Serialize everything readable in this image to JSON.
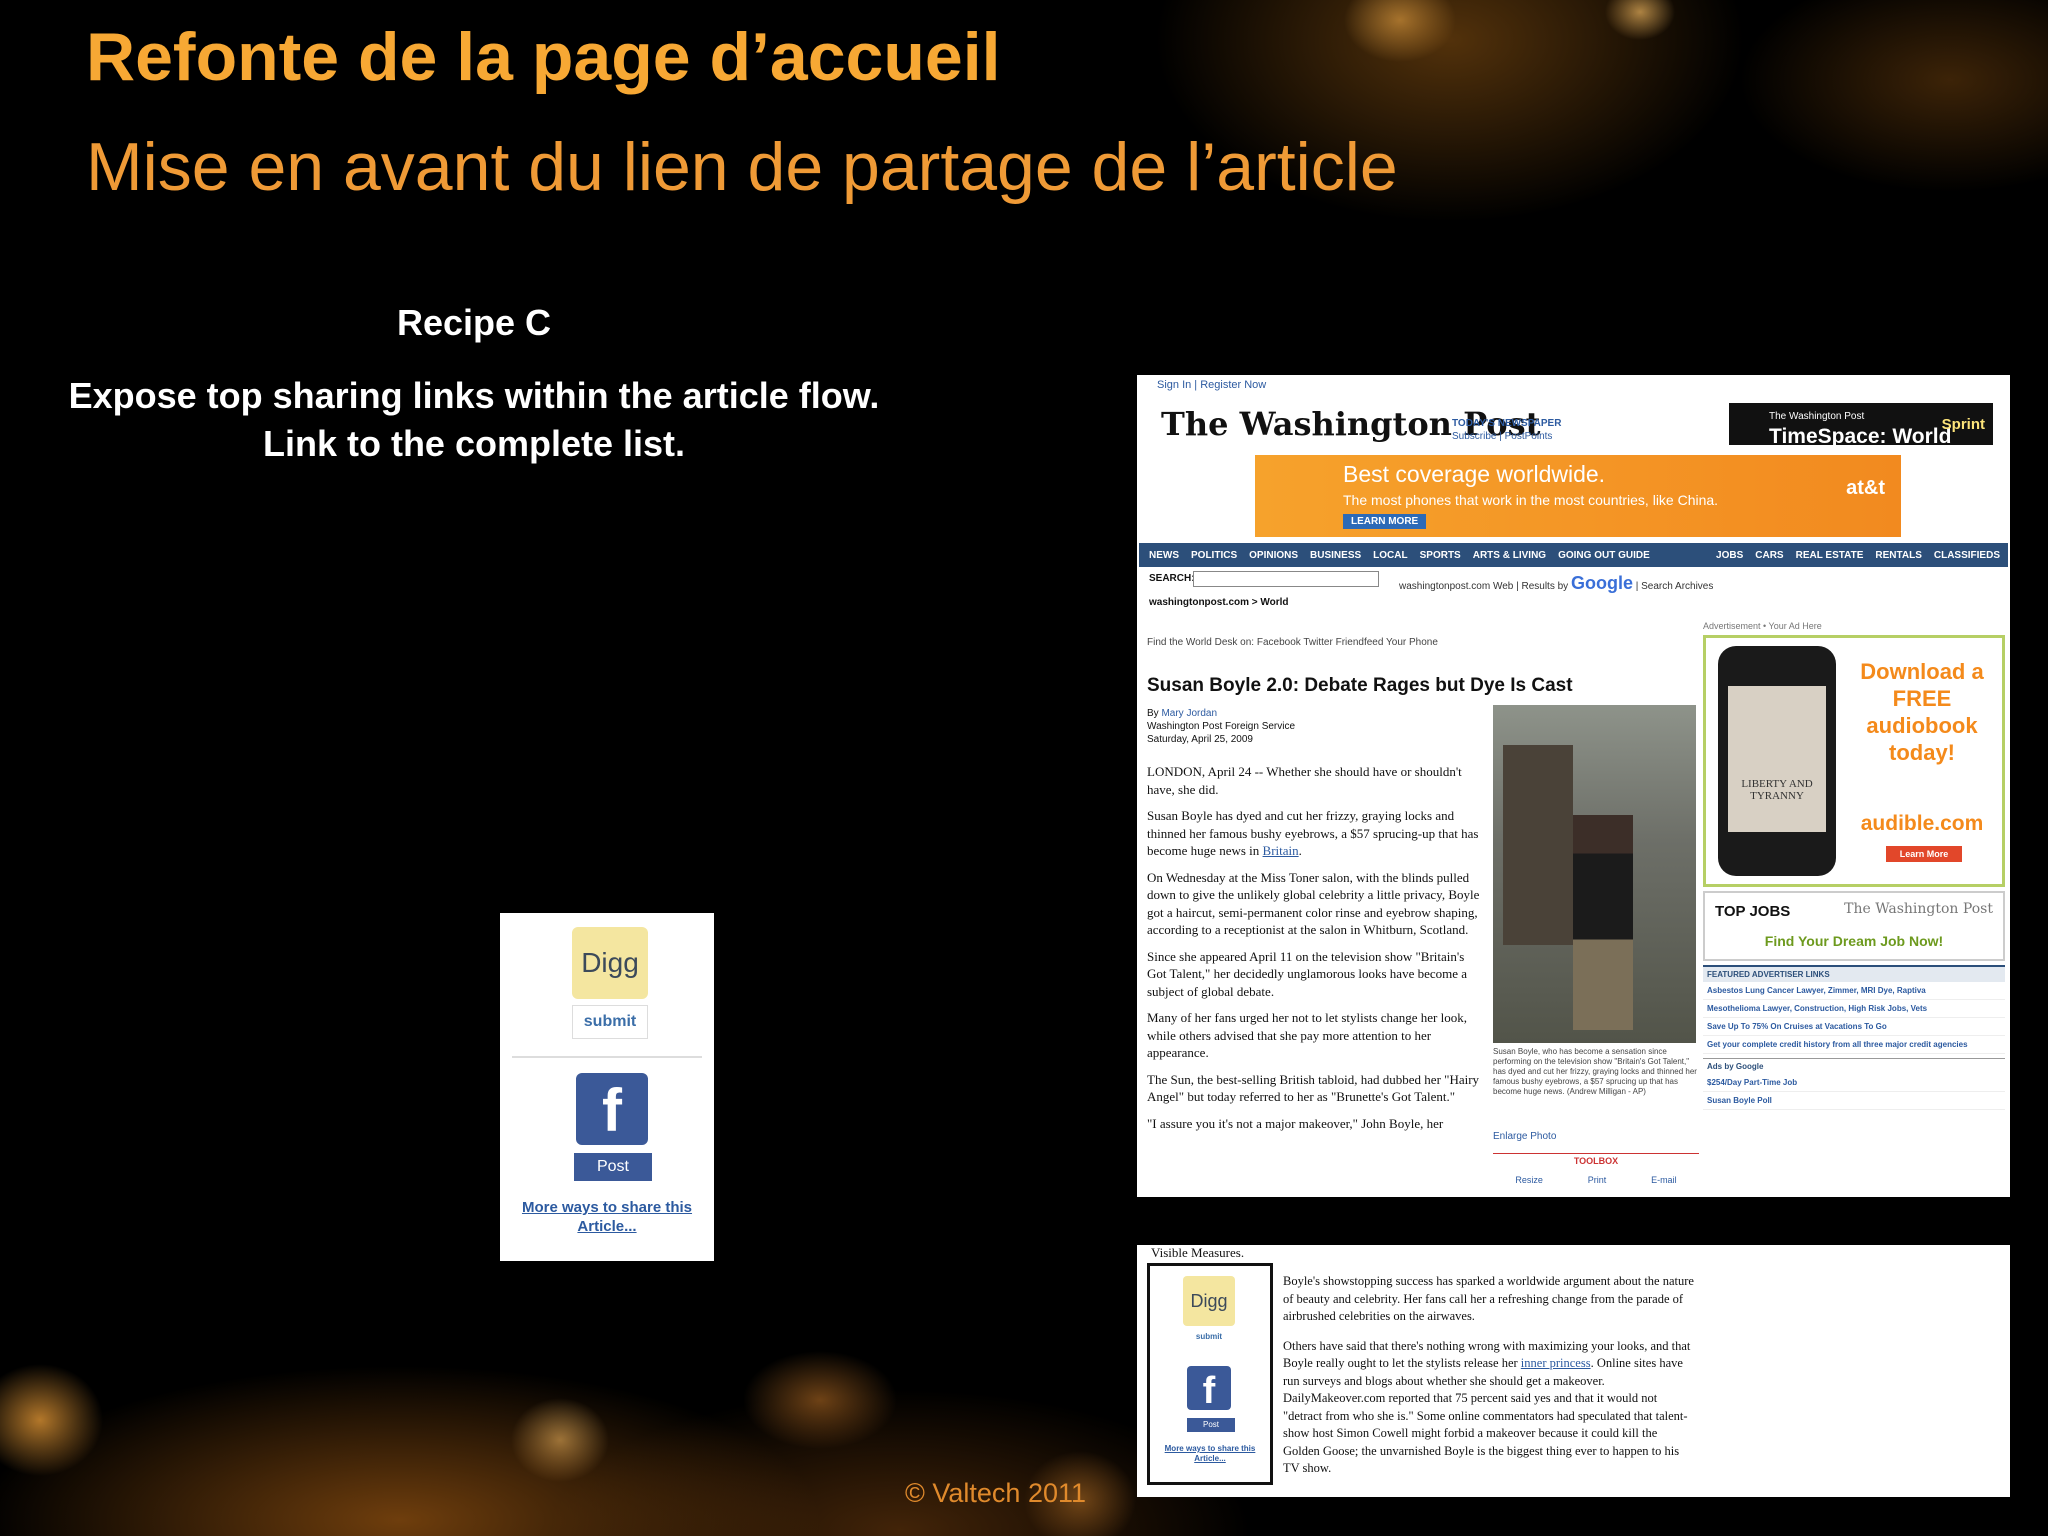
{
  "slide": {
    "title": "Refonte de la page d’accueil",
    "subtitle": "Mise en avant du lien de partage de l’article",
    "recipe": "Recipe C",
    "description": "Expose top sharing links within the article flow.  Link to the complete list.",
    "footer": "© Valtech 2011"
  },
  "share_widget": {
    "digg": "Digg",
    "submit": "submit",
    "fb_glyph": "f",
    "post": "Post",
    "more": "More ways to share this Article..."
  },
  "wapo": {
    "sign_in": "Sign In | Register Now",
    "logo": "The Washington Post",
    "todays_paper": "TODAY'S NEWSPAPER",
    "subscribe": "Subscribe | PostPoints",
    "timespace": "TimeSpace: World",
    "timespace_small": "The Washington Post",
    "sprint": "Sprint",
    "ad_headline": "Best coverage worldwide.",
    "ad_sub": "The most phones that work in the most countries, like China.",
    "ad_btn": "LEARN MORE",
    "ad_brand": "at&t",
    "nav": [
      "NEWS",
      "POLITICS",
      "OPINIONS",
      "BUSINESS",
      "LOCAL",
      "SPORTS",
      "ARTS & LIVING",
      "GOING OUT GUIDE",
      "JOBS",
      "CARS",
      "REAL ESTATE",
      "RENTALS",
      "CLASSIFIEDS"
    ],
    "search_label": "SEARCH:",
    "search_opts": "washingtonpost.com  Web | Results by",
    "google": "Google",
    "search_archives": "| Search Archives",
    "breadcrumb": "washingtonpost.com > World",
    "find_world": "Find the World Desk on:  Facebook   Twitter   Friendfeed   Your Phone",
    "headline": "Susan Boyle 2.0: Debate Rages but Dye Is Cast",
    "by": "By",
    "author": "Mary Jordan",
    "service": "Washington Post Foreign Service",
    "date": "Saturday, April 25, 2009",
    "p1": "LONDON, April 24 -- Whether she should have or shouldn't have, she did.",
    "p2": "Susan Boyle has dyed and cut her frizzy, graying locks and thinned her famous bushy eyebrows, a $57 sprucing-up that has become huge news in",
    "p2_link": "Britain",
    "p3": "On Wednesday at the Miss Toner salon, with the blinds pulled down to give the unlikely global celebrity a little privacy, Boyle got a haircut, semi-permanent color rinse and eyebrow shaping, according to a receptionist at the salon in Whitburn, Scotland.",
    "p4": "Since she appeared April 11 on the television show \"Britain's Got Talent,\" her decidedly unglamorous looks have become a subject of global debate.",
    "p5": "Many of her fans urged her not to let stylists change her look, while others advised that she pay more attention to her appearance.",
    "p6": "The Sun, the best-selling British tabloid, had dubbed her \"Hairy Angel\" but today referred to her as \"Brunette's Got Talent.\"",
    "p7": "\"I assure you it's not a major makeover,\" John Boyle, her",
    "caption": "Susan Boyle, who has become a sensation since performing on the television show \"Britain's Got Talent,\" has dyed and cut her frizzy, graying locks and thinned her famous bushy eyebrows, a $57 sprucing up that has become huge news. (Andrew Milligan - AP)",
    "enlarge": "Enlarge Photo",
    "toolbox": "TOOLBOX",
    "tools": [
      "Resize",
      "Print",
      "E-mail"
    ],
    "ad_label": "Advertisement • Your Ad Here",
    "book": "LIBERTY AND TYRANNY",
    "download": "Download a FREE audiobook today!",
    "audible": "audible.com",
    "learn_more": "Learn More",
    "top_jobs": "TOP JOBS",
    "jobs_logo": "The Washington Post",
    "dream_job": "Find Your Dream Job Now!",
    "featured": "FEATURED ADVERTISER LINKS",
    "feat_links": [
      "Asbestos Lung Cancer Lawyer, Zimmer, MRI Dye, Raptiva",
      "Mesothelioma Lawyer, Construction, High Risk Jobs, Vets",
      "Save Up To 75% On Cruises at Vacations To Go",
      "Get your complete credit history from all three major credit agencies"
    ],
    "ads_google": "Ads by Google",
    "g_links": [
      "$254/Day Part-Time Job",
      "Susan Boyle Poll"
    ]
  },
  "snippet": {
    "top": "Visible Measures.",
    "digg": "Digg",
    "submit": "submit",
    "fb_glyph": "f",
    "post": "Post",
    "more": "More ways to share this Article...",
    "p1": "Boyle's showstopping success has sparked a worldwide argument about the nature of beauty and celebrity. Her fans call her a refreshing change from the parade of airbrushed celebrities on the airwaves.",
    "p2a": "Others have said that there's nothing wrong with maximizing your looks, and that Boyle really ought to let the stylists release her",
    "p2_link": "inner princess",
    "p2b": ". Online sites have run surveys and blogs about whether she should get a makeover. DailyMakeover.com reported that 75 percent said yes and that it would not \"detract from who she is.\" Some online commentators had speculated that talent-show host Simon Cowell might forbid a makeover because it could kill the Golden Goose; the unvarnished Boyle is the biggest thing ever to happen to his TV show."
  }
}
